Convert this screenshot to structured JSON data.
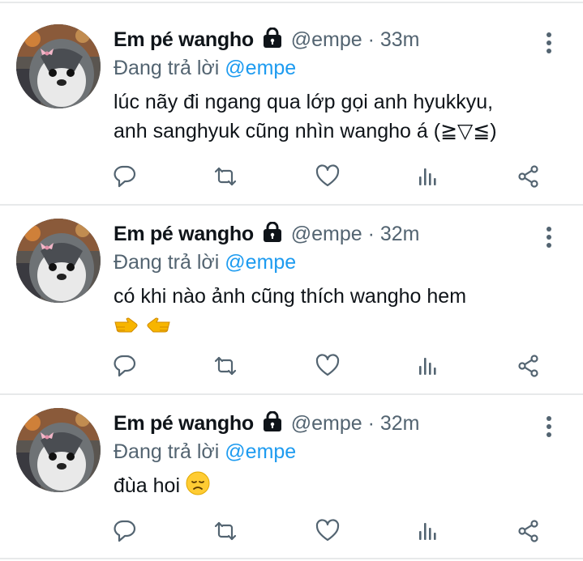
{
  "tweets": [
    {
      "name": "Em pé wangho",
      "handle": "@empe",
      "sep": "·",
      "time": "33m",
      "replying_prefix": "Đang trả lời",
      "replying_to": "@empe",
      "line1": "lúc nãy đi ngang qua lớp gọi anh hyukkyu,",
      "line2": "anh sanghyuk cũng nhìn wangho á (≧▽≦)"
    },
    {
      "name": "Em pé wangho",
      "handle": "@empe",
      "sep": "·",
      "time": "32m",
      "replying_prefix": "Đang trả lời",
      "replying_to": "@empe",
      "line1": "có khi nào ảnh cũng thích wangho hem",
      "emojis": [
        "point-right",
        "point-left"
      ]
    },
    {
      "name": "Em pé wangho",
      "handle": "@empe",
      "sep": "·",
      "time": "32m",
      "replying_prefix": "Đang trả lời",
      "replying_to": "@empe",
      "line1": "đùa hoi",
      "emojis": [
        "disappointed-face"
      ]
    }
  ],
  "colors": {
    "text": "#0f1419",
    "secondary": "#536471",
    "link": "#1d9bf0",
    "divider": "#e7e9ea"
  },
  "icons": [
    "lock-icon",
    "more-icon",
    "reply-icon",
    "retweet-icon",
    "like-icon",
    "views-icon",
    "share-icon"
  ]
}
